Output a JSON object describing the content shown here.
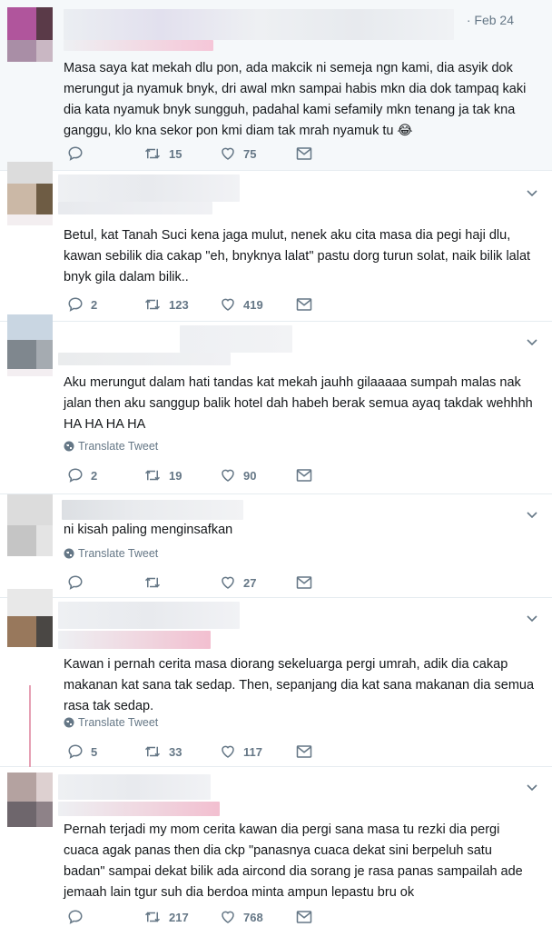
{
  "tweets": [
    {
      "date": "· Feb 24",
      "text": "Masa saya kat mekah dlu pon, ada makcik ni semeja ngn kami, dia asyik dok merungut ja nyamuk bnyk, dri awal mkn sampai habis mkn dia dok tampaq kaki dia kata nyamuk bnyk sungguh, padahal kami sefamily mkn tenang ja tak kna ganggu, klo kna sekor pon kmi diam tak mrah nyamuk tu 😂",
      "translate": "",
      "replies": "",
      "retweets": "15",
      "likes": "75"
    },
    {
      "date": "",
      "text": "Betul, kat Tanah Suci kena jaga mulut, nenek aku cita masa dia pegi haji dlu, kawan sebilik dia cakap \"eh, bnyknya lalat\" pastu dorg turun solat, naik bilik lalat bnyk gila dalam bilik..",
      "translate": "",
      "replies": "2",
      "retweets": "123",
      "likes": "419"
    },
    {
      "date": "",
      "text": "Aku merungut dalam hati tandas kat mekah jauhh gilaaaaa sumpah malas nak jalan then aku sanggup balik hotel dah habeh berak semua ayaq takdak wehhhh HA HA HA HA",
      "translate": "Translate Tweet",
      "replies": "2",
      "retweets": "19",
      "likes": "90"
    },
    {
      "date": "",
      "text": "ni kisah paling menginsafkan",
      "translate": "Translate Tweet",
      "replies": "",
      "retweets": "",
      "likes": "27"
    },
    {
      "date": "",
      "text": "Kawan i pernah cerita masa diorang sekeluarga pergi umrah, adik dia cakap makanan kat sana tak sedap. Then, sepanjang dia kat sana makanan dia semua rasa tak sedap.",
      "translate": "Translate Tweet",
      "replies": "5",
      "retweets": "33",
      "likes": "117"
    },
    {
      "date": "",
      "text": "Pernah terjadi my mom cerita kawan dia pergi sana masa tu rezki dia pergi cuaca agak panas then dia ckp \"panasnya cuaca dekat sini berpeluh satu badan\" sampai dekat bilik ada aircond dia sorang je rasa panas sampailah ade jemaah lain tgur suh dia berdoa minta ampun lepastu bru ok",
      "translate": "",
      "replies": "",
      "retweets": "217",
      "likes": "768"
    }
  ],
  "colors": {
    "text": "#14171a",
    "muted": "#657786",
    "divider": "#e6ecf0",
    "highlight_bg": "#f5f8fa"
  },
  "icons": [
    "reply-icon",
    "retweet-icon",
    "like-icon",
    "message-icon",
    "globe-icon",
    "chevron-down-icon"
  ]
}
